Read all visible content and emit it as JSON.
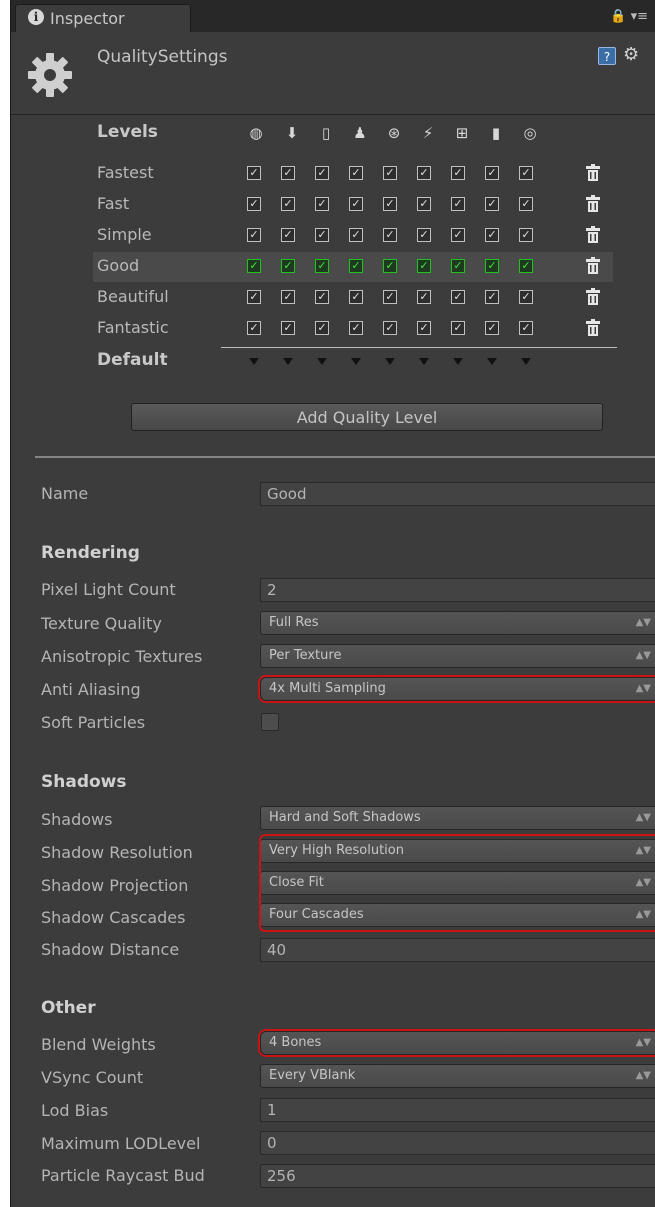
{
  "tab": {
    "label": "Inspector"
  },
  "header": {
    "title": "QualitySettings"
  },
  "matrix": {
    "heading": "Levels",
    "platform_icons": [
      "globe-icon",
      "download-icon",
      "tablet-icon",
      "android-icon",
      "blackberry-icon",
      "flash-icon",
      "windows-icon",
      "phone-icon",
      "console-icon"
    ],
    "levels": [
      {
        "name": "Fastest"
      },
      {
        "name": "Fast"
      },
      {
        "name": "Simple"
      },
      {
        "name": "Good"
      },
      {
        "name": "Beautiful"
      },
      {
        "name": "Fantastic"
      }
    ],
    "selected_level": "Good",
    "default_label": "Default",
    "add_button": "Add Quality Level"
  },
  "props": {
    "name_label": "Name",
    "name_value": "Good",
    "rendering": {
      "heading": "Rendering",
      "pixel_light_label": "Pixel Light Count",
      "pixel_light_value": "2",
      "texture_quality_label": "Texture Quality",
      "texture_quality_value": "Full Res",
      "aniso_label": "Anisotropic Textures",
      "aniso_value": "Per Texture",
      "aa_label": "Anti Aliasing",
      "aa_value": "4x Multi Sampling",
      "soft_particles_label": "Soft Particles"
    },
    "shadows": {
      "heading": "Shadows",
      "shadows_label": "Shadows",
      "shadows_value": "Hard and Soft Shadows",
      "resolution_label": "Shadow Resolution",
      "resolution_value": "Very High Resolution",
      "projection_label": "Shadow Projection",
      "projection_value": "Close Fit",
      "cascades_label": "Shadow Cascades",
      "cascades_value": "Four Cascades",
      "distance_label": "Shadow Distance",
      "distance_value": "40"
    },
    "other": {
      "heading": "Other",
      "blend_label": "Blend Weights",
      "blend_value": "4 Bones",
      "vsync_label": "VSync Count",
      "vsync_value": "Every VBlank",
      "lod_bias_label": "Lod Bias",
      "lod_bias_value": "1",
      "max_lod_label": "Maximum LODLevel",
      "max_lod_value": "0",
      "raycast_label": "Particle Raycast Bud",
      "raycast_value": "256"
    }
  },
  "colors": {
    "highlight": "#c81414",
    "selected_check": "#22c022"
  }
}
